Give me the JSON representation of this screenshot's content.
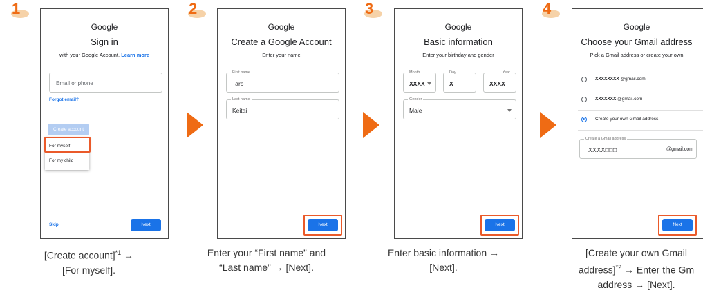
{
  "steps": [
    {
      "number": "1",
      "google": "Google",
      "title": "Sign in",
      "subtitle": "with your Google Account.",
      "subtitle_link": "Learn more",
      "email_placeholder": "Email or phone",
      "forgot_email": "Forgot email?",
      "create_account": "Create account",
      "menu": [
        "For myself",
        "For my child"
      ],
      "skip": "Skip",
      "next": "Next",
      "caption_line1": "[Create account]",
      "caption_sup": "*1",
      "caption_line1_end": " →",
      "caption_line2": "[For myself]."
    },
    {
      "number": "2",
      "google": "Google",
      "title": "Create a Google Account",
      "subtitle": "Enter your name",
      "first_name_label": "First name",
      "first_name_value": "Taro",
      "last_name_label": "Last name",
      "last_name_value": "Keitai",
      "next": "Next",
      "caption_line1": "Enter your “First name” and",
      "caption_line2": "“Last name” → [Next]."
    },
    {
      "number": "3",
      "google": "Google",
      "title": "Basic information",
      "subtitle": "Enter your birthday and gender",
      "month_label": "Month",
      "month_value": "XXXX",
      "day_label": "Day",
      "day_value": "X",
      "year_label": "Year",
      "year_value": "XXXX",
      "gender_label": "Gender",
      "gender_value": "Male",
      "next": "Next",
      "caption_line1": "Enter basic information →",
      "caption_line2": "[Next]."
    },
    {
      "number": "4",
      "google": "Google",
      "title": "Choose your Gmail address",
      "subtitle": "Pick a Gmail address or create your own",
      "option1_name": "XXXXXXXX",
      "option1_domain": "@gmail.com",
      "option2_name": "XXXXXXX",
      "option2_domain": "@gmail.com",
      "option3": "Create your own Gmail address",
      "custom_label": "Create a Gmail address",
      "custom_value": "XXXX□□□",
      "custom_domain": "@gmail.com",
      "next": "Next",
      "caption_line1": "[Create your own Gmail",
      "caption_line2a": "address]",
      "caption_sup": "*2",
      "caption_line2b": " → Enter the Gm",
      "caption_line3": "address → [Next]."
    }
  ],
  "colors": {
    "accent_orange": "#ef6b14",
    "highlight_border": "#ea5a2a",
    "google_blue": "#1a73e8"
  }
}
